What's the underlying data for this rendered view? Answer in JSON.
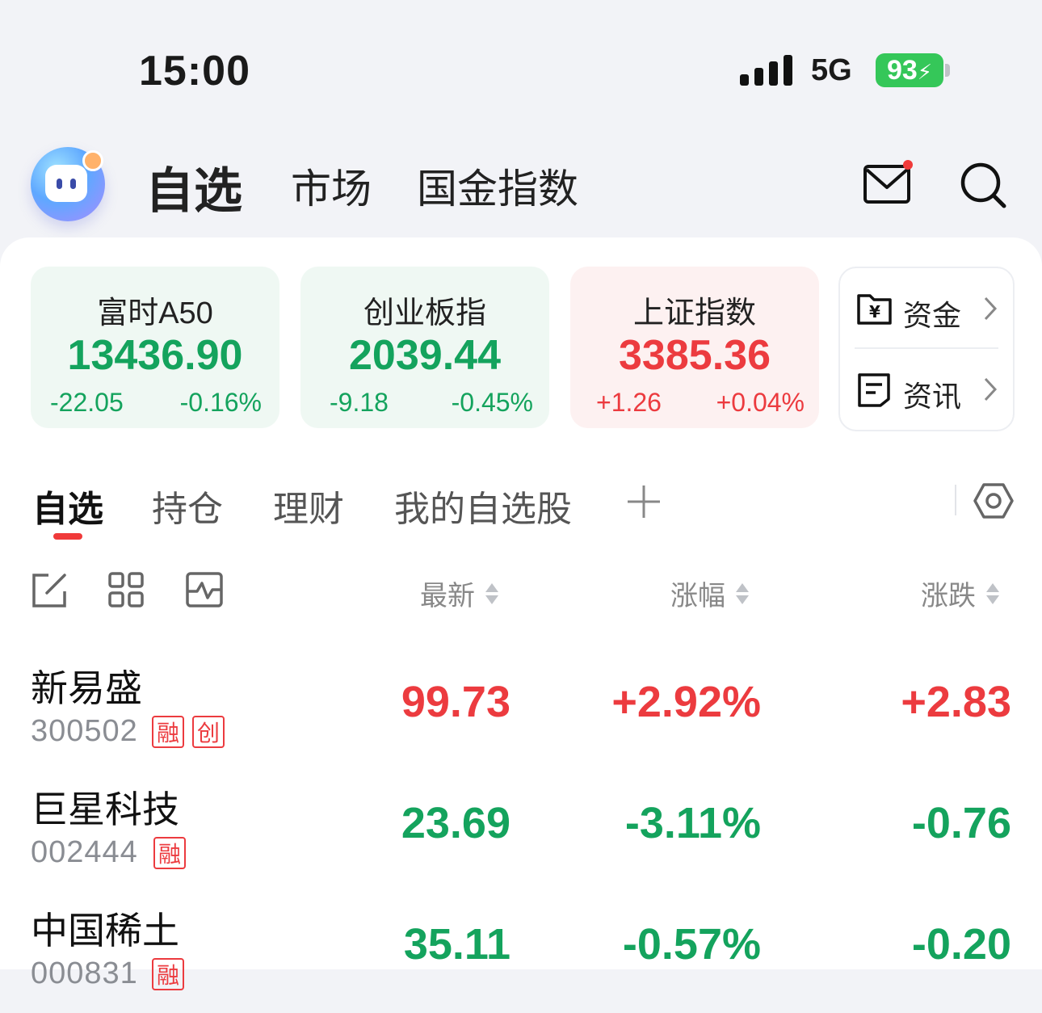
{
  "status_bar": {
    "time": "15:00",
    "network": "5G",
    "battery": "93"
  },
  "nav": {
    "tabs": [
      {
        "label": "自选",
        "active": true
      },
      {
        "label": "市场",
        "active": false
      },
      {
        "label": "国金指数",
        "active": false
      }
    ],
    "icons": [
      "app-logo-icon",
      "mail-icon",
      "search-icon"
    ]
  },
  "indices": [
    {
      "name": "富时A50",
      "value": "13436.90",
      "change": "-22.05",
      "percent": "-0.16%",
      "trend": "down"
    },
    {
      "name": "创业板指",
      "value": "2039.44",
      "change": "-9.18",
      "percent": "-0.45%",
      "trend": "down"
    },
    {
      "name": "上证指数",
      "value": "3385.36",
      "change": "+1.26",
      "percent": "+0.04%",
      "trend": "up"
    }
  ],
  "side_links": [
    {
      "label": "资金",
      "icon": "yuan-folder-icon"
    },
    {
      "label": "资讯",
      "icon": "news-doc-icon"
    }
  ],
  "watch_tabs": [
    {
      "label": "自选",
      "active": true
    },
    {
      "label": "持仓",
      "active": false
    },
    {
      "label": "理财",
      "active": false
    },
    {
      "label": "我的自选股",
      "active": false
    }
  ],
  "columns": {
    "latest": "最新",
    "change_pct": "涨幅",
    "change": "涨跌"
  },
  "stocks": [
    {
      "name": "新易盛",
      "code": "300502",
      "tags": [
        "融",
        "创"
      ],
      "price": "99.73",
      "pct": "+2.92%",
      "chg": "+2.83",
      "trend": "up"
    },
    {
      "name": "巨星科技",
      "code": "002444",
      "tags": [
        "融"
      ],
      "price": "23.69",
      "pct": "-3.11%",
      "chg": "-0.76",
      "trend": "down"
    },
    {
      "name": "中国稀土",
      "code": "000831",
      "tags": [
        "融"
      ],
      "price": "35.11",
      "pct": "-0.57%",
      "chg": "-0.20",
      "trend": "down"
    }
  ],
  "colors": {
    "up": "#ec3b3f",
    "down": "#14a35d",
    "accent": "#f03a3a"
  }
}
